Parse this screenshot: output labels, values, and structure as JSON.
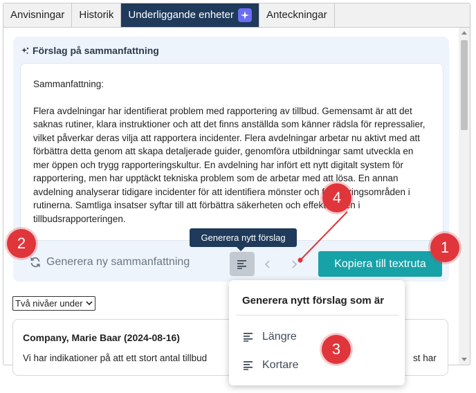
{
  "tabs": [
    {
      "label": "Anvisningar"
    },
    {
      "label": "Historik"
    },
    {
      "label": "Underliggande enheter"
    },
    {
      "label": "Anteckningar"
    }
  ],
  "suggestion": {
    "title": "Förslag på sammanfattning",
    "heading": "Sammanfattning:",
    "body": "Flera avdelningar har identifierat problem med rapportering av tillbud. Gemensamt är att det saknas rutiner, klara instruktioner och att det finns anställda som känner rädsla för repressalier, vilket påverkar deras vilja att rapportera incidenter. Flera avdelningar arbetar nu aktivt med att förbättra detta genom att skapa detaljerade guider, genomföra utbildningar samt utveckla en mer öppen och trygg rapporteringskultur. En avdelning har infört ett nytt digitalt system för rapportering, men har upptäckt tekniska problem som de arbetar med att lösa. En annan avdelning analyserar tidigare incidenter för att identifiera mönster och förbättringsområden i rutinerna. Samtliga insatser syftar till att förbättra säkerheten och effektiviteten i tillbudsrapporteringen."
  },
  "actions": {
    "regenerate_label": "Generera ny sammanfattning",
    "copy_label": "Kopiera till textruta",
    "tooltip": "Generera nytt förslag"
  },
  "level_select": {
    "selected": "Två nivåer under"
  },
  "note": {
    "author": "Company, Marie Baar (2024-08-16)",
    "text": "Vi har indikationer på att ett stort antal tillbud",
    "text_end": "st har"
  },
  "dropdown": {
    "title": "Generera nytt förslag som är",
    "items": [
      {
        "label": "Längre"
      },
      {
        "label": "Kortare"
      }
    ]
  },
  "markers": [
    "1",
    "2",
    "3",
    "4"
  ],
  "colors": {
    "tab_active": "#1f3a5a",
    "copy_button": "#17a2a8",
    "marker": "#e0353b",
    "panel_bg": "#eef4fc"
  }
}
